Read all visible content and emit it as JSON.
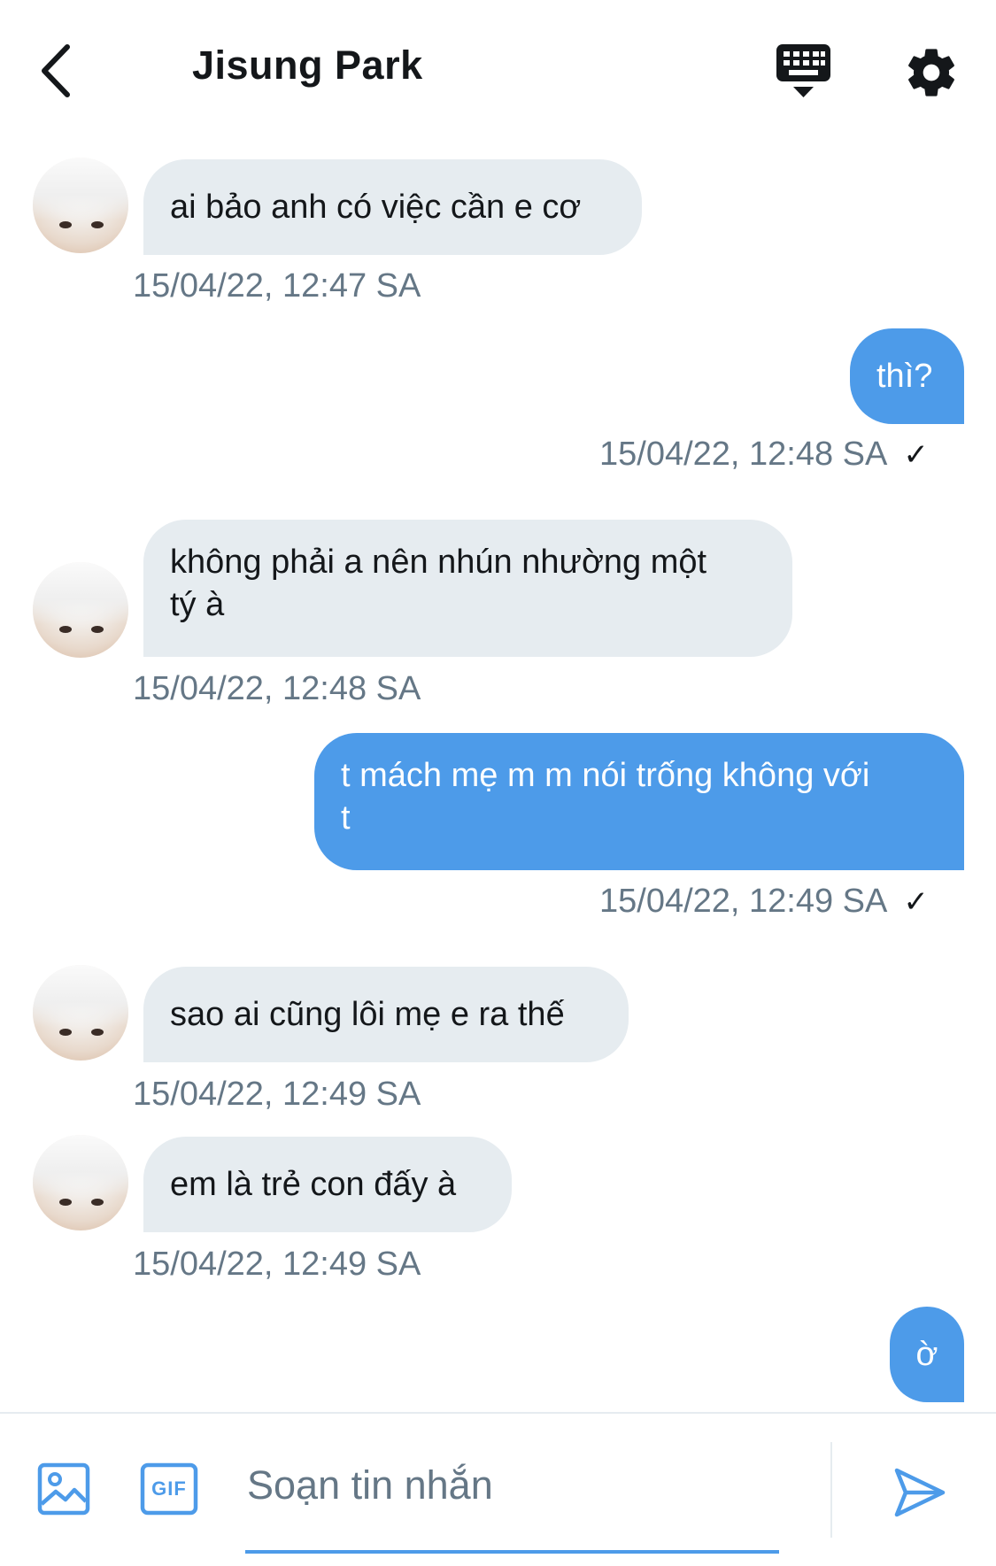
{
  "header": {
    "title": "Jisung Park"
  },
  "messages": [
    {
      "side": "in",
      "text": "ai bảo anh có việc cần e cơ",
      "time": "15/04/22, 12:47 SA"
    },
    {
      "side": "out",
      "text": "thì?",
      "time": "15/04/22, 12:48 SA",
      "status": "✓"
    },
    {
      "side": "in",
      "text_lines": [
        "không phải a nên nhún nhường một",
        "tý à"
      ],
      "time": "15/04/22, 12:48 SA"
    },
    {
      "side": "out",
      "text_lines": [
        "t mách mẹ m m nói trống không với",
        "t"
      ],
      "time": "15/04/22, 12:49 SA",
      "status": "✓"
    },
    {
      "side": "in",
      "text": "sao ai cũng lôi mẹ e ra thế",
      "time": "15/04/22, 12:49 SA"
    },
    {
      "side": "in",
      "text": "em là trẻ con đấy à",
      "time": "15/04/22, 12:49 SA"
    },
    {
      "side": "out",
      "text": "ờ"
    }
  ],
  "composer": {
    "placeholder": "Soạn tin nhắn",
    "gif_label": "GIF"
  },
  "colors": {
    "accent": "#4d9be9",
    "incoming_bubble": "#e6ecf0",
    "muted_text": "#657786"
  }
}
